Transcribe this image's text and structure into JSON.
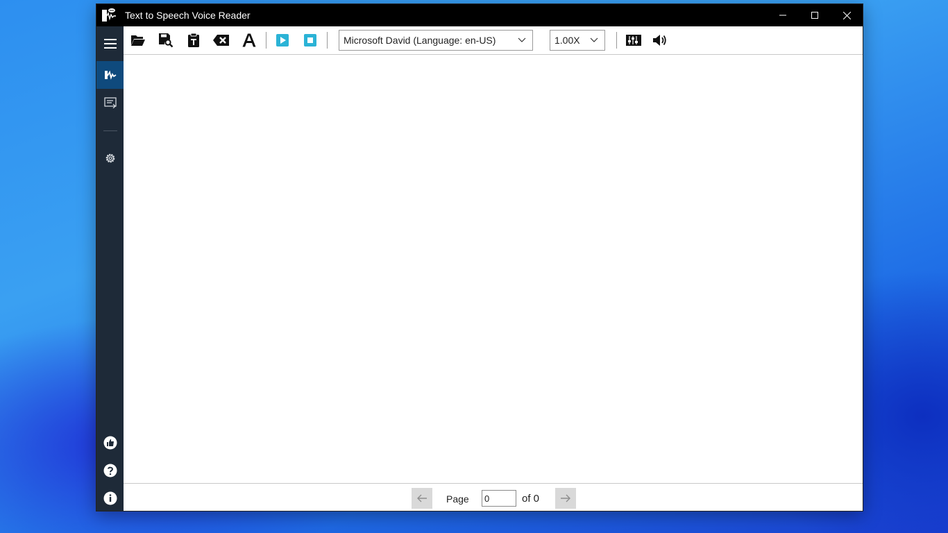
{
  "window": {
    "title": "Text to Speech Voice Reader",
    "controls": [
      "minimize-icon",
      "maximize-icon",
      "close-icon"
    ]
  },
  "sidebar": {
    "items": [
      {
        "name": "menu",
        "icon": "hamburger-icon"
      },
      {
        "name": "reader",
        "icon": "speech-waveform-icon",
        "active": true
      },
      {
        "name": "text-list",
        "icon": "text-list-icon"
      },
      {
        "name": "settings",
        "icon": "gear-icon"
      },
      {
        "name": "like",
        "icon": "thumbs-up-icon"
      },
      {
        "name": "help",
        "icon": "help-circle-icon"
      },
      {
        "name": "about",
        "icon": "info-icon"
      }
    ]
  },
  "toolbar": {
    "buttons": [
      {
        "name": "open",
        "icon": "folder-open-icon"
      },
      {
        "name": "save",
        "icon": "save-search-icon"
      },
      {
        "name": "paste",
        "icon": "clipboard-text-icon"
      },
      {
        "name": "clear",
        "icon": "backspace-icon"
      },
      {
        "name": "font",
        "icon": "font-icon"
      },
      {
        "name": "play",
        "icon": "play-icon"
      },
      {
        "name": "stop",
        "icon": "stop-icon"
      },
      {
        "name": "voice-settings",
        "icon": "equalizer-icon"
      },
      {
        "name": "volume",
        "icon": "volume-icon"
      }
    ],
    "voice": "Microsoft David (Language: en-US)",
    "speed": "1.00X",
    "accent_color": "#2bb3d6"
  },
  "footer": {
    "page_label": "Page",
    "page_value": "0",
    "of_label": "of 0"
  }
}
